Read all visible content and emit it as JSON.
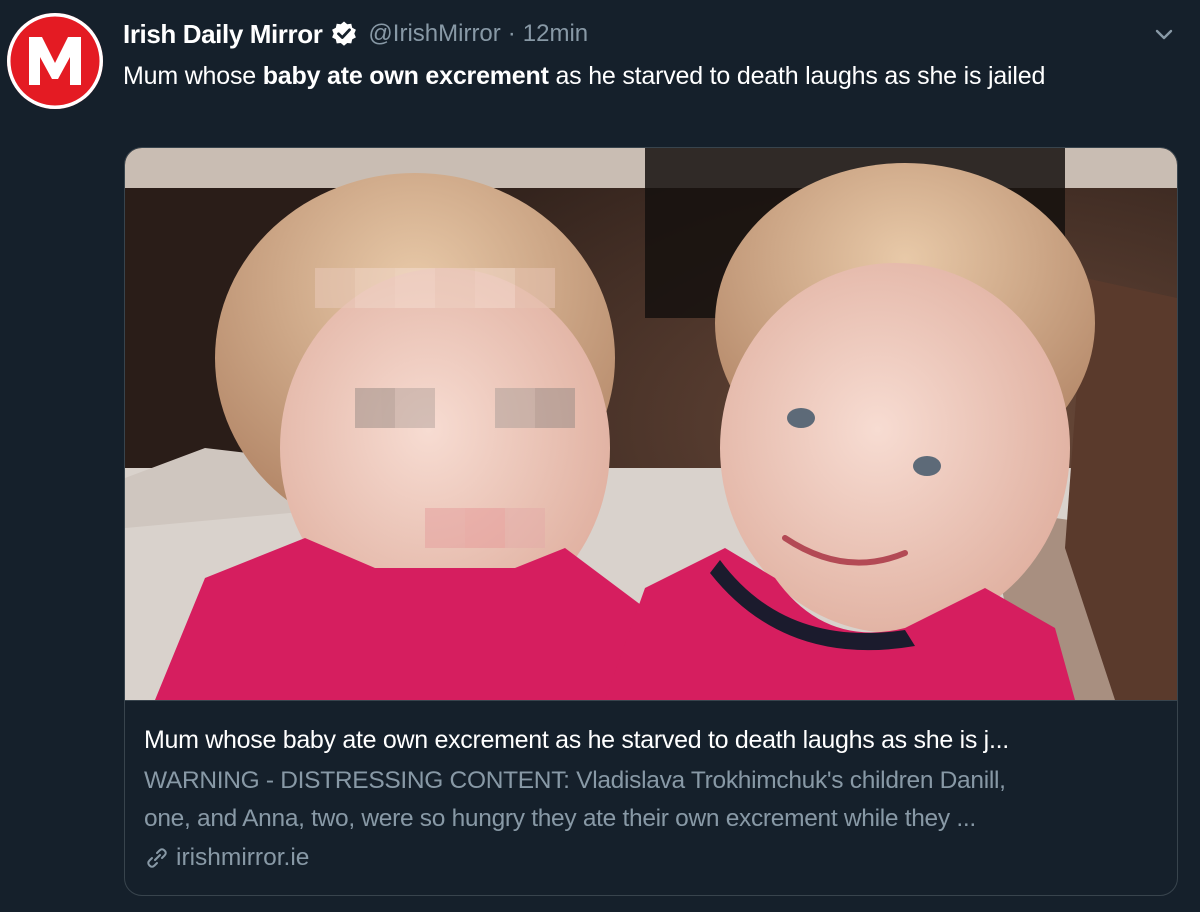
{
  "author": {
    "display_name": "Irish Daily Mirror",
    "handle": "@IrishMirror",
    "separator": "·",
    "timestamp": "12min",
    "avatar_letter": "M",
    "avatar_color": "#e41b23",
    "verified": true
  },
  "tweet": {
    "text_before": "Mum whose ",
    "text_bold": "baby ate own excrement",
    "text_after": " as he starved to death laughs as she is jailed"
  },
  "card": {
    "image_description_icon": "photo",
    "title": "Mum whose baby ate own excrement as he starved to death laughs as she is j...",
    "description_line1": "WARNING - DISTRESSING CONTENT: Vladislava Trokhimchuk's children Danill,",
    "description_line2": "one, and Anna, two, were so hungry they ate their own excrement while they ...",
    "domain": "irishmirror.ie"
  },
  "icons": {
    "verified": "verified-badge-icon",
    "caret": "chevron-down-icon",
    "link": "link-icon"
  },
  "colors": {
    "background": "#15202b",
    "secondary_text": "#8899a6",
    "border": "#38444d",
    "primary_text": "#ffffff"
  }
}
